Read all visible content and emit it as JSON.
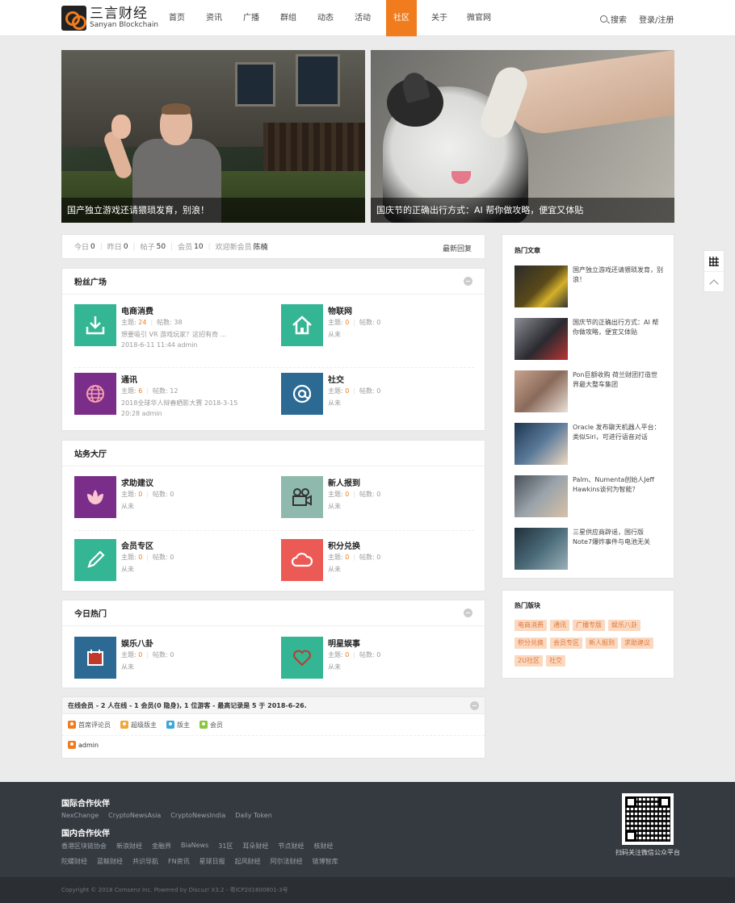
{
  "brand": {
    "name_cn": "三言财经",
    "name_en": "Sanyan Blockchain",
    "accent": "#f07c1e"
  },
  "nav": {
    "items": [
      "首页",
      "资讯",
      "广播",
      "群组",
      "动态",
      "活动",
      "社区",
      "关于",
      "微官网"
    ],
    "active": "社区",
    "search_label": "搜索",
    "login_label": "登录/注册"
  },
  "hero": [
    {
      "caption": "国产独立游戏还请猥琐发育，别浪！"
    },
    {
      "caption": "国庆节的正确出行方式：AI 帮你做攻略，便宜又体贴"
    }
  ],
  "stats": {
    "today_label": "今日",
    "today": "0",
    "yesterday_label": "昨日",
    "yesterday": "0",
    "posts_label": "帖子",
    "posts": "50",
    "members_label": "会员",
    "members": "10",
    "welcome_label": "欢迎新会员",
    "newest_member": "陈楠",
    "latest_label": "最新回复"
  },
  "sections": [
    {
      "title": "粉丝广场",
      "forums": [
        {
          "name": "电商消费",
          "threads_label": "主题:",
          "threads": "24",
          "posts_label": "帖数:",
          "posts": "38",
          "last_line1": "想要吸引 VR 游戏玩家？这招有奇 ...",
          "last_line2": "2018-6-11 11:44 admin",
          "icon": "download-tray-icon",
          "color": "#34b593"
        },
        {
          "name": "物联网",
          "threads_label": "主题:",
          "threads": "0",
          "posts_label": "帖数:",
          "posts": "0",
          "last_line1": "从未",
          "last_line2": "",
          "icon": "house-icon",
          "color": "#34b593"
        },
        {
          "name": "通讯",
          "threads_label": "主题:",
          "threads": "6",
          "posts_label": "帖数:",
          "posts": "12",
          "last_line1": "2018全球华人辩春晒影大赛 2018-3-15",
          "last_line2": "20:28 admin",
          "icon": "globe-icon",
          "color": "#7b2d8a"
        },
        {
          "name": "社交",
          "threads_label": "主题:",
          "threads": "0",
          "posts_label": "帖数:",
          "posts": "0",
          "last_line1": "从未",
          "last_line2": "",
          "icon": "at-sign-icon",
          "color": "#2c6a94"
        }
      ]
    },
    {
      "title": "站务大厅",
      "forums": [
        {
          "name": "求助建议",
          "threads_label": "主题:",
          "threads": "0",
          "posts_label": "帖数:",
          "posts": "0",
          "last_line1": "从未",
          "last_line2": "",
          "icon": "lotus-icon",
          "color": "#7b2d8a"
        },
        {
          "name": "新人报到",
          "threads_label": "主题:",
          "threads": "0",
          "posts_label": "帖数:",
          "posts": "0",
          "last_line1": "从未",
          "last_line2": "",
          "icon": "video-camera-icon",
          "color": "#8fb9ad"
        },
        {
          "name": "会员专区",
          "threads_label": "主题:",
          "threads": "0",
          "posts_label": "帖数:",
          "posts": "0",
          "last_line1": "从未",
          "last_line2": "",
          "icon": "pencil-icon",
          "color": "#34b593"
        },
        {
          "name": "积分兑换",
          "threads_label": "主题:",
          "threads": "0",
          "posts_label": "帖数:",
          "posts": "0",
          "last_line1": "从未",
          "last_line2": "",
          "icon": "cloud-icon",
          "color": "#ec5a55"
        }
      ]
    },
    {
      "title": "今日热门",
      "forums": [
        {
          "name": "娱乐八卦",
          "threads_label": "主题:",
          "threads": "0",
          "posts_label": "帖数:",
          "posts": "0",
          "last_line1": "从未",
          "last_line2": "",
          "icon": "calendar-icon",
          "color": "#2c6a94"
        },
        {
          "name": "明星娱事",
          "threads_label": "主题:",
          "threads": "0",
          "posts_label": "帖数:",
          "posts": "0",
          "last_line1": "从未",
          "last_line2": "",
          "icon": "heart-icon",
          "color": "#34b593"
        }
      ]
    }
  ],
  "online": {
    "title": "在线会员 - 2 人在线 - 1 会员(0 隐身), 1 位游客 - 最高记录是 5 于 2018-6-26.",
    "legend": [
      {
        "label": "首席评论员",
        "color": "#f07c1e"
      },
      {
        "label": "超级版主",
        "color": "#f0a83a"
      },
      {
        "label": "版主",
        "color": "#3aa7d8"
      },
      {
        "label": "会员",
        "color": "#8cc63f"
      }
    ],
    "members": [
      {
        "name": "admin",
        "color": "#f07c1e"
      }
    ]
  },
  "sidebar": {
    "hot_articles_title": "热门文章",
    "articles": [
      "国产独立游戏还请猥琐发育，别浪！",
      "国庆节的正确出行方式：AI 帮你做攻略，便宜又体贴",
      "Pon巨额收购 荷兰财团打造世界最大整车集团",
      "Oracle 发布聊天机器人平台：类似Siri，可进行语音对话",
      "Palm、Numenta创始人Jeff Hawkins谈何为智能？",
      "三星供应商辟谣，国行版Note7爆炸事件与电池无关"
    ],
    "hot_blocks_title": "热门版块",
    "tags": [
      "电商消费",
      "通讯",
      "广播专版",
      "娱乐八卦",
      "积分兑换",
      "会员专区",
      "新人报到",
      "求助建议",
      "2U社区",
      "社交"
    ]
  },
  "footer": {
    "intl_title": "国际合作伙伴",
    "intl_links": [
      "NexChange",
      "CryptoNewsAsia",
      "CryptoNewsIndia",
      "Daily Token"
    ],
    "domestic_title": "国内合作伙伴",
    "domestic_row1": [
      "香港区块链协会",
      "新浪财经",
      "金融界",
      "BiaNews",
      "31区",
      "耳朵财经",
      "节点财经",
      "核财经"
    ],
    "domestic_row2": [
      "陀螺财经",
      "蓝鲸财经",
      "共识导航",
      "FN资讯",
      "星球日报",
      "起风财经",
      "阿尔法财经",
      "链博智库"
    ],
    "qr_caption": "扫码关注微信公众平台",
    "copyright": "Copyright © 2018 Comsenz Inc. Powered by Discuz! X3.2 - 粤ICP201600801-3号"
  }
}
